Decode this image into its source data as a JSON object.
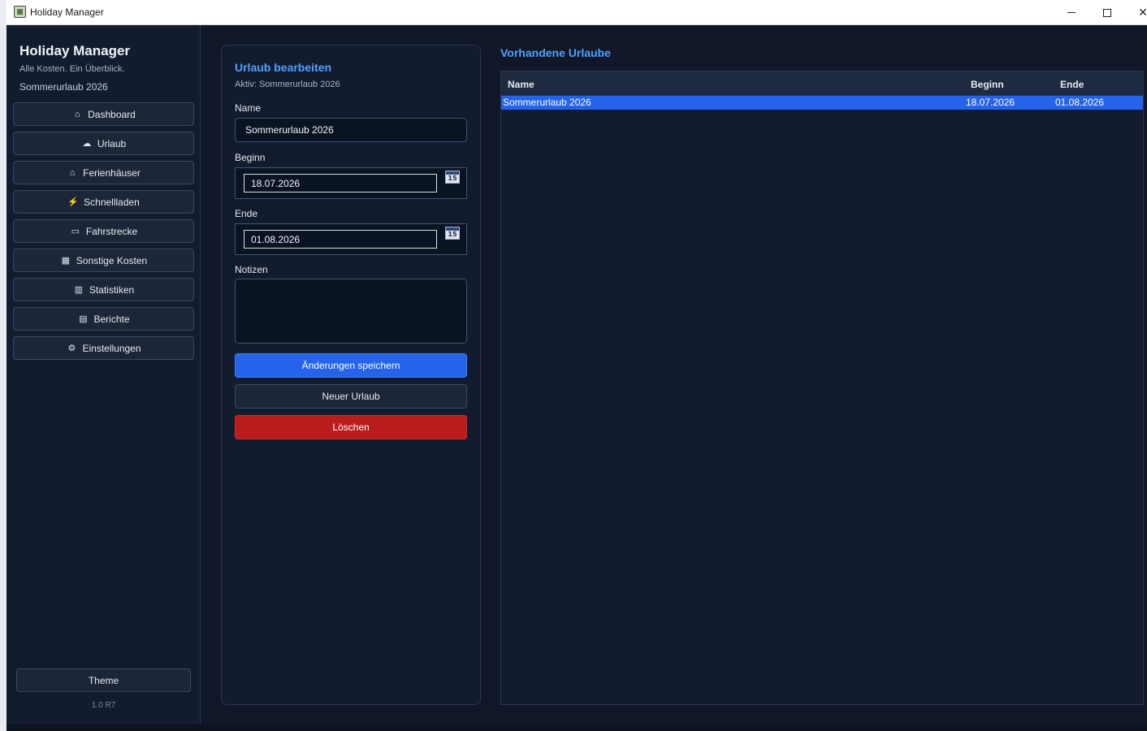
{
  "window": {
    "title": "Holiday Manager"
  },
  "sidebar": {
    "brand_title": "Holiday Manager",
    "brand_subtitle": "Alle Kosten. Ein Überblick.",
    "active_trip": "Sommerurlaub 2026",
    "items": [
      {
        "label": "Dashboard",
        "icon": "dashboard-icon",
        "glyph": "⌂"
      },
      {
        "label": "Urlaub",
        "icon": "vacation-icon",
        "glyph": "☁"
      },
      {
        "label": "Ferienhäuser",
        "icon": "house-icon",
        "glyph": "⌂"
      },
      {
        "label": "Schnellladen",
        "icon": "lightning-icon",
        "glyph": "⚡"
      },
      {
        "label": "Fahrstrecke",
        "icon": "car-icon",
        "glyph": "▭"
      },
      {
        "label": "Sonstige Kosten",
        "icon": "cart-icon",
        "glyph": "▦"
      },
      {
        "label": "Statistiken",
        "icon": "chart-icon",
        "glyph": "▥"
      },
      {
        "label": "Berichte",
        "icon": "document-icon",
        "glyph": "▤"
      },
      {
        "label": "Einstellungen",
        "icon": "gear-icon",
        "glyph": "⚙"
      }
    ],
    "theme_label": "Theme",
    "version": "1.0 R7"
  },
  "form": {
    "title": "Urlaub bearbeiten",
    "subtitle": "Aktiv: Sommerurlaub 2026",
    "name_label": "Name",
    "name_value": "Sommerurlaub 2026",
    "start_label": "Beginn",
    "start_value": "18.07.2026",
    "end_label": "Ende",
    "end_value": "01.08.2026",
    "calendar_day": "15",
    "notes_label": "Notizen",
    "notes_value": "",
    "save_label": "Änderungen speichern",
    "new_label": "Neuer Urlaub",
    "delete_label": "Löschen"
  },
  "list": {
    "title": "Vorhandene Urlaube",
    "columns": [
      "Name",
      "Beginn",
      "Ende"
    ],
    "rows": [
      {
        "name": "Sommerurlaub 2026",
        "start": "18.07.2026",
        "end": "01.08.2026",
        "selected": true
      }
    ]
  },
  "colors": {
    "accent": "#4ea1ff",
    "primary": "#2563eb",
    "danger": "#b91c1c",
    "background": "#0f1728"
  }
}
